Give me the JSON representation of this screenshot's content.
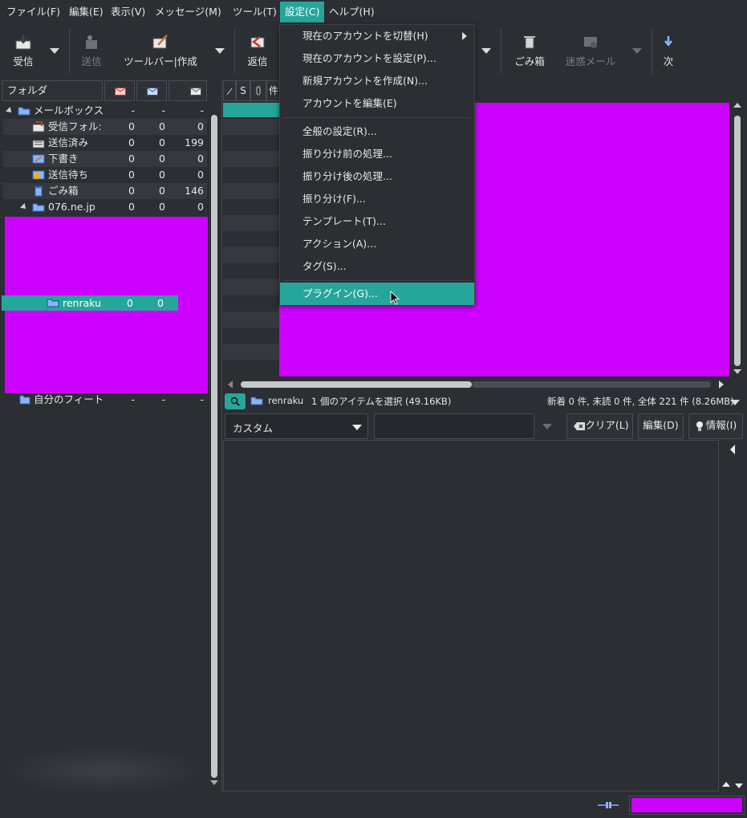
{
  "menubar": {
    "items": [
      {
        "label": "ファイル(F)"
      },
      {
        "label": "編集(E)"
      },
      {
        "label": "表示(V)"
      },
      {
        "label": "メッセージ(M)"
      },
      {
        "label": "ツール(T)"
      },
      {
        "label": "設定(C)"
      },
      {
        "label": "ヘルプ(H)"
      }
    ]
  },
  "toolbar": {
    "receive": "受信",
    "send": "送信",
    "compose": "ツールバー|作成",
    "reply": "返信",
    "trash": "ごみ箱",
    "junk": "迷惑メール",
    "next": "次"
  },
  "folder_pane": {
    "header": "フォルダ",
    "rows": [
      {
        "name": "メールボックス",
        "c1": "-",
        "c2": "-",
        "c3": "-"
      },
      {
        "name": "受信フォル:",
        "c1": "0",
        "c2": "0",
        "c3": "0"
      },
      {
        "name": "送信済み",
        "c1": "0",
        "c2": "0",
        "c3": "199"
      },
      {
        "name": "下書き",
        "c1": "0",
        "c2": "0",
        "c3": "0"
      },
      {
        "name": "送信待ち",
        "c1": "0",
        "c2": "0",
        "c3": "0"
      },
      {
        "name": "ごみ箱",
        "c1": "0",
        "c2": "0",
        "c3": "146"
      },
      {
        "name": "076.ne.jp",
        "c1": "0",
        "c2": "0",
        "c3": "0"
      }
    ],
    "selected": {
      "name": "renraku",
      "c1": "0",
      "c2": "0"
    },
    "bottom": {
      "name": "自分のフィート",
      "c1": "-",
      "c2": "-",
      "c3": "-"
    }
  },
  "msg_header": {
    "col_s": "S",
    "col_subject": "件"
  },
  "settings_menu": {
    "items": [
      {
        "label": "現在のアカウントを切替(H)"
      },
      {
        "label": "現在のアカウントを設定(P)..."
      },
      {
        "label": "新規アカウントを作成(N)..."
      },
      {
        "label": "アカウントを編集(E)"
      },
      {
        "label": "全般の設定(R)..."
      },
      {
        "label": "振り分け前の処理..."
      },
      {
        "label": "振り分け後の処理..."
      },
      {
        "label": "振り分け(F)..."
      },
      {
        "label": "テンプレート(T)..."
      },
      {
        "label": "アクション(A)..."
      },
      {
        "label": "タグ(S)..."
      },
      {
        "label": "プラグイン(G)..."
      }
    ]
  },
  "status": {
    "folder": "renraku",
    "selection": "1 個のアイテムを選択 (49.16KB)",
    "summary": "新着 0 件, 未読 0 件, 全体 221 件 (8.26MB)"
  },
  "search": {
    "mode": "カスタム",
    "query": "",
    "clear": "クリア(L)",
    "edit": "編集(D)",
    "info": "情報(I)"
  }
}
